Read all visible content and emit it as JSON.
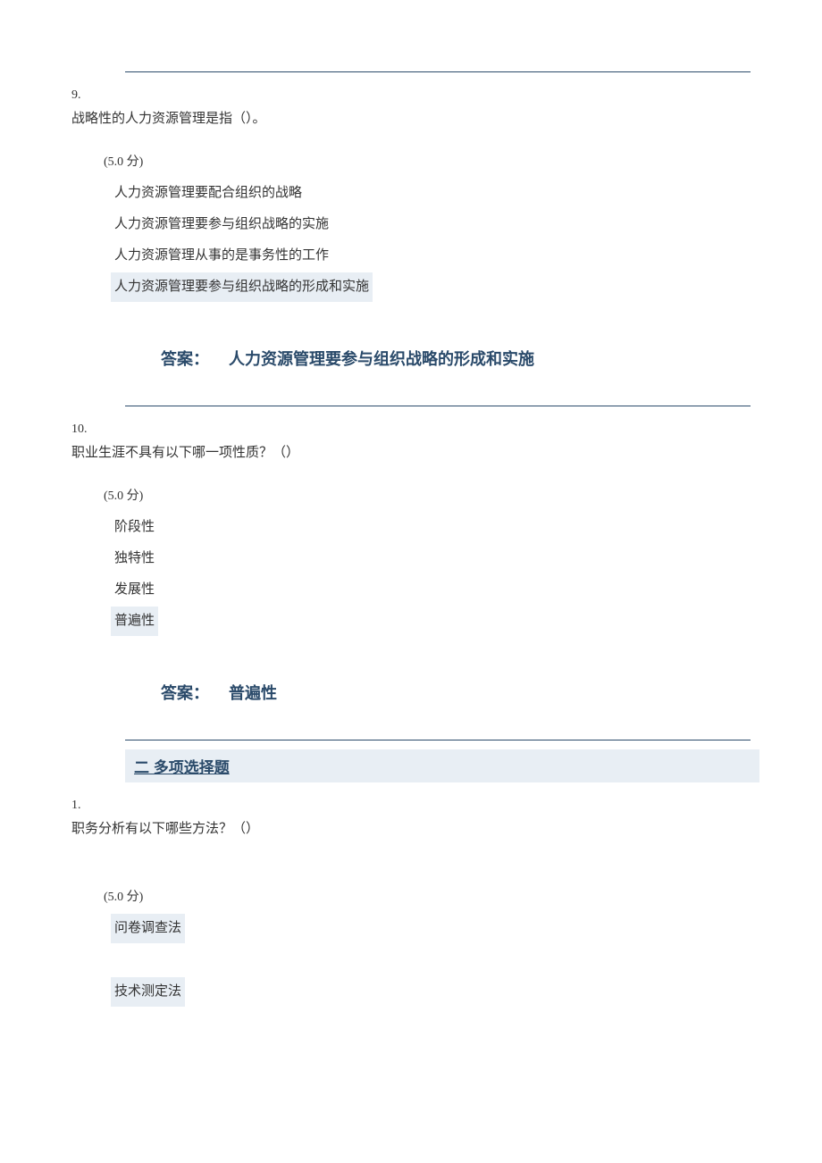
{
  "q9": {
    "number": "9.",
    "stem": "战略性的人力资源管理是指（）。",
    "points": "(5.0  分)",
    "options": [
      {
        "text": "人力资源管理要配合组织的战略",
        "highlight": false
      },
      {
        "text": "人力资源管理要参与组织战略的实施",
        "highlight": false
      },
      {
        "text": "人力资源管理从事的是事务性的工作",
        "highlight": false
      },
      {
        "text": "人力资源管理要参与组织战略的形成和实施",
        "highlight": true
      }
    ],
    "answer_label": "答案：",
    "answer_text": "人力资源管理要参与组织战略的形成和实施"
  },
  "q10": {
    "number": "10.",
    "stem": "职业生涯不具有以下哪一项性质？（）",
    "points": "(5.0  分)",
    "options": [
      {
        "text": "阶段性",
        "highlight": false
      },
      {
        "text": "独特性",
        "highlight": false
      },
      {
        "text": "发展性",
        "highlight": false
      },
      {
        "text": "普遍性",
        "highlight": true
      }
    ],
    "answer_label": "答案：",
    "answer_text": "普遍性"
  },
  "section2": {
    "title": "二  多项选择题"
  },
  "mcq1": {
    "number": "1.",
    "stem": "职务分析有以下哪些方法？（）",
    "points": "(5.0  分)",
    "options": [
      {
        "text": "问卷调查法",
        "highlight": true
      },
      {
        "text": "技术测定法",
        "highlight": true
      }
    ]
  }
}
